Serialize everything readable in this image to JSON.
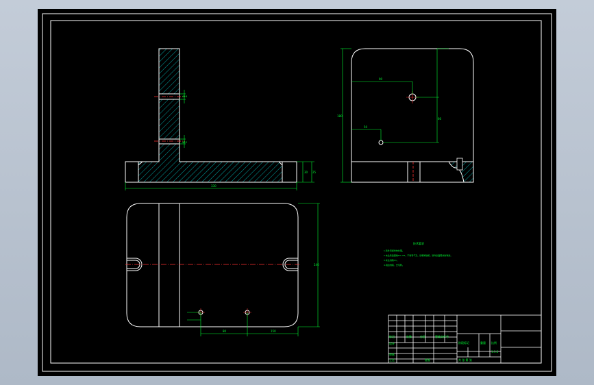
{
  "drawing": {
    "tech_title": "技术要求",
    "tech_notes": [
      "1.铸件须经时效处理。",
      "2.未注铸造圆角R3~R5，不得有气孔、砂眼等缺陷，铸件表面需涂防锈漆。",
      "3.未注倒角C1。",
      "4.锐边倒钝，去毛刺。"
    ],
    "dims": {
      "front_width": "330",
      "front_height": "30",
      "front_side": "25",
      "hole_upper": "Φ16",
      "hole_lower": "Φ12",
      "right_height": "180",
      "right_width1": "90",
      "right_width2": "50",
      "right_side": "60",
      "top_height": "240",
      "top_x1": "80",
      "top_x2": "150"
    },
    "title_block": {
      "labels_left": [
        "标记",
        "处数",
        "分区",
        "更改文件号",
        "签名",
        "年月日"
      ],
      "labels_bottom": [
        "设计",
        "审核",
        "工艺",
        "批准",
        "标准化"
      ],
      "part_name": "阶段标记",
      "weight": "重量",
      "scale_label": "比例",
      "scale": "1:1.5",
      "sheet": "共  张  第  张"
    }
  }
}
